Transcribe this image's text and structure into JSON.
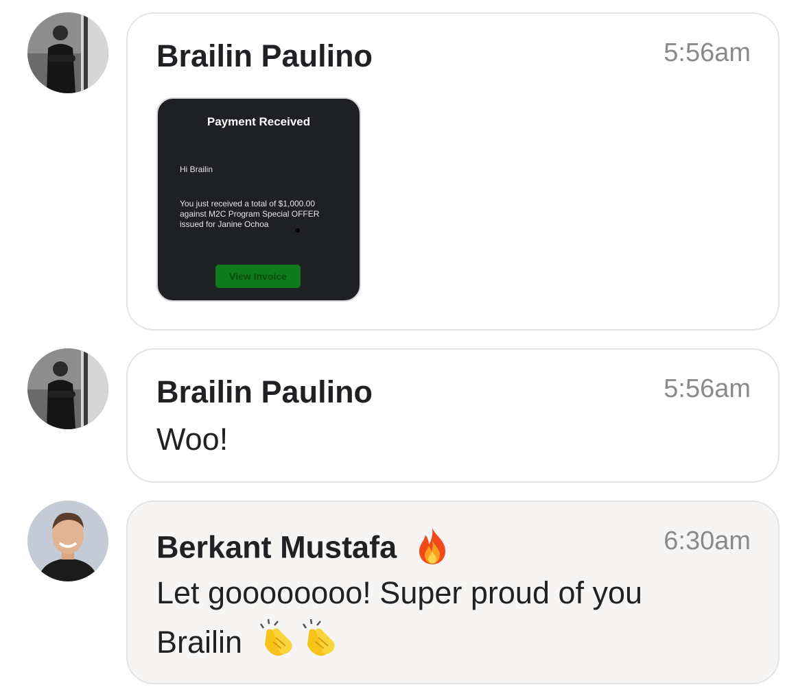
{
  "messages": [
    {
      "sender": "Brailin Paulino",
      "time": "5:56am",
      "avatar_icon": "user-avatar-man-dark-sweater",
      "attachment": {
        "title": "Payment Received",
        "greeting": "Hi Brailin",
        "body": "You just received a total of $1,000.00 against M2C Program Special OFFER issued for Janine Ochoa",
        "button_label": "View Invoice",
        "button_color": "#0f7a19"
      }
    },
    {
      "sender": "Brailin Paulino",
      "time": "5:56am",
      "avatar_icon": "user-avatar-man-dark-sweater",
      "text": "Woo!"
    },
    {
      "sender": "Berkant Mustafa",
      "sender_emoji": "fire-emoji",
      "time": "6:30am",
      "avatar_icon": "user-avatar-smiling-man-hoodie",
      "text_line1": "Let goooooooo! Super proud of you",
      "text_line2": "Brailin",
      "text_emoji": "clapping-hands-emoji"
    }
  ],
  "colors": {
    "bubble_border": "#e3e3e3",
    "highlight_bubble_bg": "#f6f5f4",
    "time_gray": "#8a8a8a",
    "card_bg": "#1f2023"
  }
}
